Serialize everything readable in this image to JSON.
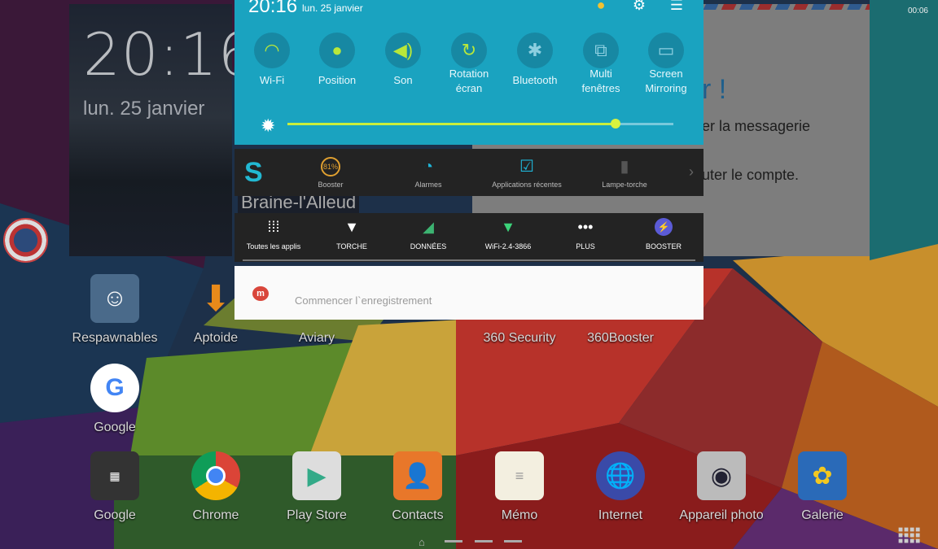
{
  "status": {
    "clock": "00:06"
  },
  "weather_widget": {
    "time": "20:16",
    "date": "lun. 25 janvier",
    "city": "Braine-l'Alleud"
  },
  "mail_widget": {
    "greeting": "r !",
    "line1": "er la messagerie",
    "line2": "uter le compte."
  },
  "quick_panel": {
    "time": "20:16",
    "date": "lun. 25 janvier",
    "top_icons": [
      "avatar-icon",
      "gear-icon",
      "edit-panel-icon"
    ],
    "toggles": [
      {
        "label": "Wi-Fi",
        "icon": "wifi-icon",
        "active": true
      },
      {
        "label": "Position",
        "icon": "location-icon",
        "active": true
      },
      {
        "label": "Son",
        "icon": "volume-icon",
        "active": true
      },
      {
        "label": "Rotation écran",
        "icon": "rotation-icon",
        "active": true
      },
      {
        "label": "Bluetooth",
        "icon": "bluetooth-icon",
        "active": false
      },
      {
        "label": "Multi fenêtres",
        "icon": "multi-window-icon",
        "active": false
      },
      {
        "label": "Screen Mirroring",
        "icon": "screen-mirroring-icon",
        "active": false
      }
    ],
    "brightness_percent": 85,
    "colors": {
      "panel": "#1aa3c0",
      "active": "#b8e83a"
    }
  },
  "shortcuts_bar": {
    "items": [
      {
        "label": "Booster",
        "badge": "81%",
        "icon": "booster-gauge-icon"
      },
      {
        "label": "Alarmes",
        "icon": "alarm-clock-icon"
      },
      {
        "label": "Applications récentes",
        "icon": "recent-apps-icon"
      },
      {
        "label": "Lampe-torche",
        "icon": "flashlight-icon"
      }
    ]
  },
  "toolbar2": {
    "items": [
      {
        "label": "Toutes les applis",
        "icon": "grid-icon"
      },
      {
        "label": "TORCHE",
        "icon": "torch-icon"
      },
      {
        "label": "DONNÉES",
        "icon": "signal-icon"
      },
      {
        "label": "WiFi-2.4-3866",
        "icon": "wifi-icon"
      },
      {
        "label": "PLUS",
        "icon": "more-icon"
      },
      {
        "label": "BOOSTER",
        "icon": "booster-icon"
      }
    ]
  },
  "notification": {
    "text": "Commencer l`enregistrement"
  },
  "home_apps": [
    {
      "label": "Respawnables"
    },
    {
      "label": "Aptoide"
    },
    {
      "label": "Aviary"
    },
    {
      "label": "360 Security"
    },
    {
      "label": "360Booster"
    },
    {
      "label": "Google"
    }
  ],
  "dock": [
    {
      "label": "Google"
    },
    {
      "label": "Chrome"
    },
    {
      "label": "Play Store"
    },
    {
      "label": "Contacts"
    },
    {
      "label": "Mémo"
    },
    {
      "label": "Internet"
    },
    {
      "label": "Appareil photo"
    },
    {
      "label": "Galerie"
    }
  ]
}
